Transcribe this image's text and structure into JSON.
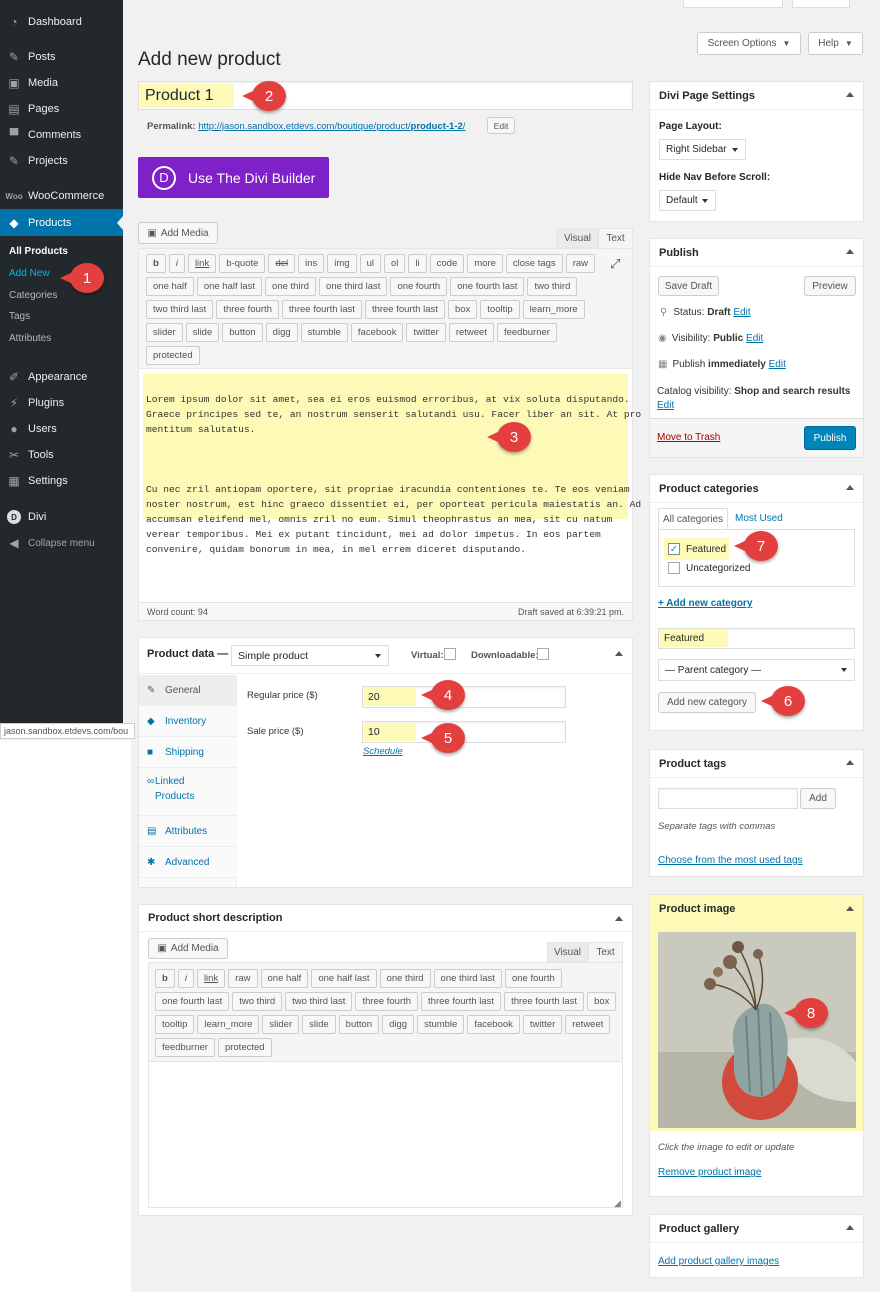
{
  "sidebar": {
    "dashboard": "Dashboard",
    "posts": "Posts",
    "media": "Media",
    "pages": "Pages",
    "comments": "Comments",
    "projects": "Projects",
    "woocommerce": "WooCommerce",
    "products": "Products",
    "sub": {
      "all": "All Products",
      "addnew": "Add New",
      "categories": "Categories",
      "tags": "Tags",
      "attributes": "Attributes"
    },
    "appearance": "Appearance",
    "plugins": "Plugins",
    "users": "Users",
    "tools": "Tools",
    "settings": "Settings",
    "divi": "Divi",
    "collapse": "Collapse menu"
  },
  "statusbar_url": "jason.sandbox.etdevs.com/bou",
  "top": {
    "screen_options": "Screen Options",
    "help": "Help"
  },
  "page_title": "Add new product",
  "title_value": "Product 1",
  "permalink": {
    "label": "Permalink:",
    "url_base": "http://jason.sandbox.etdevs.com/boutique/product/",
    "slug": "product-1-2",
    "url_end": "/",
    "edit": "Edit"
  },
  "divi_builder": {
    "logo": "D",
    "label": "Use The Divi Builder"
  },
  "editor": {
    "add_media": "Add Media",
    "tab_visual": "Visual",
    "tab_text": "Text",
    "content_p1": "Lorem ipsum dolor sit amet, sea ei eros euismod erroribus, at vix soluta disputando.\nGraece principes sed te, an nostrum senserit salutandi usu. Facer liber an sit. At pro\nmentitum salutatus.",
    "content_p2": "Cu nec zril antiopam oportere, sit propriae iracundia contentiones te. Te eos veniam\nnoster nostrum, est hinc graeco dissentiet ei, per oporteat pericula maiestatis an. Ad\naccumsan eleifend mel, omnis zril no eum. Simul theophrastus an mea, sit cu natum\nverear temporibus. Mei ex putant tincidunt, mei ad dolor impetus. In eos partem\nconvenire, quidam bonorum in mea, in mel errem diceret disputando.",
    "word_count": "Word count: 94",
    "draft_saved": "Draft saved at 6:39:21 pm.",
    "qt_row1": [
      "b",
      "i",
      "link",
      "b-quote",
      "del",
      "ins",
      "img",
      "ul",
      "ol",
      "li",
      "code",
      "more",
      "close tags",
      "raw"
    ],
    "qt_row2": [
      "one half",
      "one half last",
      "one third",
      "one third last",
      "one fourth",
      "one fourth last",
      "two third"
    ],
    "qt_row3": [
      "two third last",
      "three fourth",
      "three fourth last",
      "three fourth last",
      "box",
      "tooltip",
      "learn_more"
    ],
    "qt_row4": [
      "slider",
      "slide",
      "button",
      "digg",
      "stumble",
      "facebook",
      "twitter",
      "retweet",
      "feedburner"
    ],
    "qt_row5": [
      "protected"
    ]
  },
  "product_data": {
    "label": "Product data —",
    "type": "Simple product",
    "virtual": "Virtual:",
    "downloadable": "Downloadable:",
    "tabs": [
      "General",
      "Inventory",
      "Shipping",
      "Linked\nProducts",
      "Attributes",
      "Advanced"
    ],
    "regular_label": "Regular price ($)",
    "regular_value": "20",
    "sale_label": "Sale price ($)",
    "sale_value": "10",
    "schedule": "Schedule"
  },
  "short_desc": {
    "title": "Product short description",
    "add_media": "Add Media",
    "tab_visual": "Visual",
    "tab_text": "Text",
    "row1": [
      "b",
      "i",
      "link",
      "raw",
      "one half",
      "one half last",
      "one third",
      "one third last",
      "one fourth"
    ],
    "row2": [
      "one fourth last",
      "two third",
      "two third last",
      "three fourth",
      "three fourth last",
      "three fourth last",
      "box"
    ],
    "row3": [
      "tooltip",
      "learn_more",
      "slider",
      "slide",
      "button",
      "digg",
      "stumble",
      "facebook",
      "twitter",
      "retweet"
    ],
    "row4": [
      "feedburner",
      "protected"
    ]
  },
  "divi_settings": {
    "title": "Divi Page Settings",
    "layout_label": "Page Layout:",
    "layout_value": "Right Sidebar",
    "hide_nav_label": "Hide Nav Before Scroll:",
    "hide_nav_value": "Default"
  },
  "publish": {
    "title": "Publish",
    "save_draft": "Save Draft",
    "preview": "Preview",
    "status_label": "Status:",
    "status_value": "Draft",
    "visibility_label": "Visibility:",
    "visibility_value": "Public",
    "publish_label": "Publish",
    "publish_value": "immediately",
    "catalog_label": "Catalog visibility:",
    "catalog_value": "Shop and search results",
    "edit": "Edit",
    "trash": "Move to Trash",
    "publish_btn": "Publish"
  },
  "categories": {
    "title": "Product categories",
    "tab_all": "All categories",
    "tab_used": "Most Used",
    "items": [
      {
        "label": "Featured",
        "checked": true
      },
      {
        "label": "Uncategorized",
        "checked": false
      }
    ],
    "add_new_link": "+ Add new category",
    "new_value": "Featured",
    "parent": "— Parent category —",
    "add_btn": "Add new category"
  },
  "tags": {
    "title": "Product tags",
    "add": "Add",
    "hint": "Separate tags with commas",
    "choose": "Choose from the most used tags"
  },
  "image": {
    "title": "Product image",
    "hint": "Click the image to edit or update",
    "remove": "Remove product image"
  },
  "gallery": {
    "title": "Product gallery",
    "add": "Add product gallery images"
  },
  "badges": [
    "1",
    "2",
    "3",
    "4",
    "5",
    "6",
    "7",
    "8"
  ],
  "colors": {
    "sidebar": "#23282d",
    "active": "#0073aa",
    "divi": "#7e21c9",
    "highlight": "#fdfab7",
    "badge": "#e43f3f",
    "publish_btn": "#0085ba"
  }
}
